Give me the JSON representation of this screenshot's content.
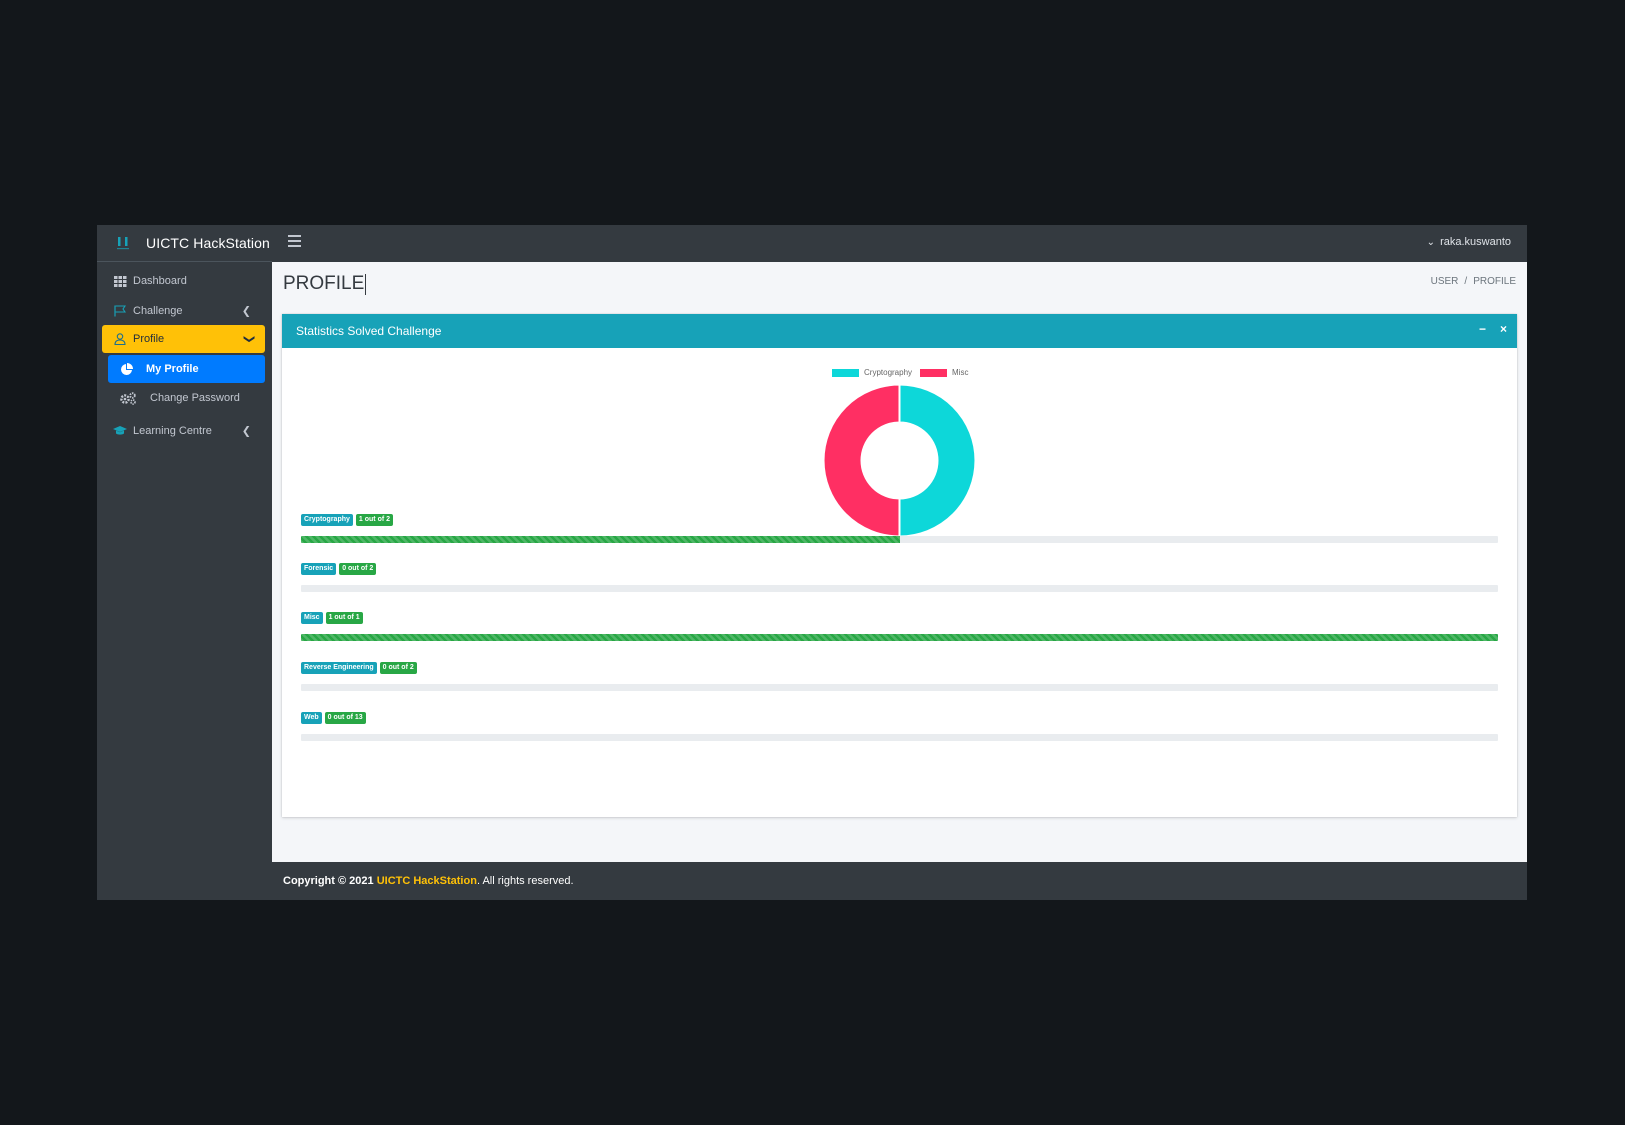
{
  "app": {
    "title": "UICTC HackStation",
    "logo_text": "UICTC"
  },
  "header": {
    "username": "raka.kuswanto"
  },
  "sidebar": {
    "items": [
      {
        "label": "Dashboard",
        "icon": "grid-icon"
      },
      {
        "label": "Challenge",
        "icon": "flag-icon"
      },
      {
        "label": "Profile",
        "icon": "user-icon"
      },
      {
        "label": "My Profile",
        "icon": "chart-pie-icon"
      },
      {
        "label": "Change Password",
        "icon": "cogs-icon"
      },
      {
        "label": "Learning Centre",
        "icon": "graduation-cap-icon"
      }
    ]
  },
  "page": {
    "title": "PROFILE",
    "breadcrumb": [
      "USER",
      "/",
      "PROFILE"
    ]
  },
  "card": {
    "title": "Statistics Solved Challenge",
    "minimize": "−",
    "close": "×"
  },
  "chart_data": {
    "type": "doughnut",
    "categories": [
      "Cryptography",
      "Misc"
    ],
    "values": [
      1,
      1
    ],
    "colors": [
      "#0dd7d9",
      "#ff2f63"
    ],
    "legend_position": "top"
  },
  "progress": [
    {
      "category": "Cryptography",
      "status": "1 out of 2",
      "solved": 1,
      "total": 2
    },
    {
      "category": "Forensic",
      "status": "0 out of 2",
      "solved": 0,
      "total": 2
    },
    {
      "category": "Misc",
      "status": "1 out of 1",
      "solved": 1,
      "total": 1
    },
    {
      "category": "Reverse Engineering",
      "status": "0 out of 2",
      "solved": 0,
      "total": 2
    },
    {
      "category": "Web",
      "status": "0 out of 13",
      "solved": 0,
      "total": 13
    }
  ],
  "footer": {
    "prefix": "Copyright © 2021 ",
    "brand": "UICTC HackStation",
    "suffix": ". All rights reserved."
  }
}
